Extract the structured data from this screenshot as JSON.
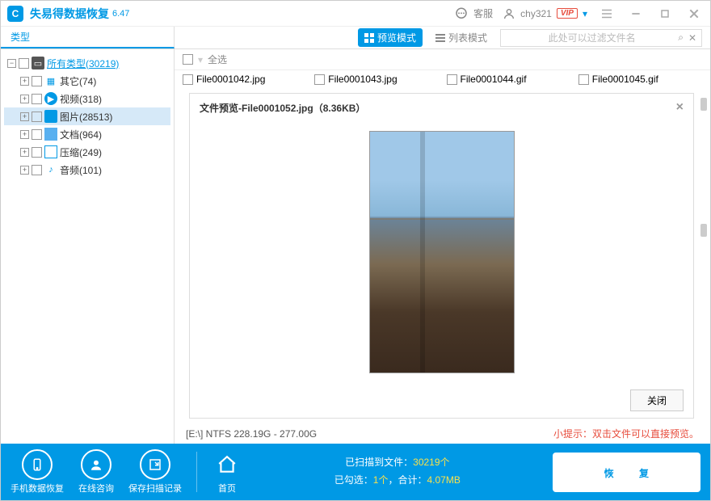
{
  "titlebar": {
    "app_name": "失易得数据恢复",
    "version": "6.47",
    "customer_service": "客服",
    "username": "chy321",
    "vip": "VIP"
  },
  "tabs": {
    "type_tab": "类型"
  },
  "toolbar": {
    "preview_mode": "预览模式",
    "list_mode": "列表模式",
    "filter_placeholder": "此处可以过滤文件名"
  },
  "tree": {
    "root": {
      "label": "所有类型(30219)"
    },
    "items": [
      {
        "label": "其它(74)",
        "icon": "blocks"
      },
      {
        "label": "视频(318)",
        "icon": "play"
      },
      {
        "label": "图片(28513)",
        "icon": "img",
        "hl": true
      },
      {
        "label": "文档(964)",
        "icon": "folder"
      },
      {
        "label": "压缩(249)",
        "icon": "zip"
      },
      {
        "label": "音频(101)",
        "icon": "music"
      }
    ]
  },
  "content": {
    "select_all": "全选",
    "files": [
      {
        "name": "File0001042.jpg"
      },
      {
        "name": "File0001043.jpg"
      },
      {
        "name": "File0001044.gif"
      },
      {
        "name": "File0001045.gif"
      }
    ]
  },
  "preview": {
    "title": "文件预览-File0001052.jpg（8.36KB）",
    "close_btn": "关闭"
  },
  "status": {
    "disk": "[E:\\] NTFS 228.19G - 277.00G",
    "tip": "小提示：双击文件可以直接预览。"
  },
  "bottom": {
    "phone": "手机数据恢复",
    "online": "在线咨询",
    "save": "保存扫描记录",
    "home": "首页",
    "scanned_pre": "已扫描到文件：",
    "scanned_count": "30219个",
    "selected_pre": "已勾选：",
    "selected_count": "1个",
    "total_pre": "，合计：",
    "total_size": "4.07MB",
    "recover": "恢 复"
  }
}
